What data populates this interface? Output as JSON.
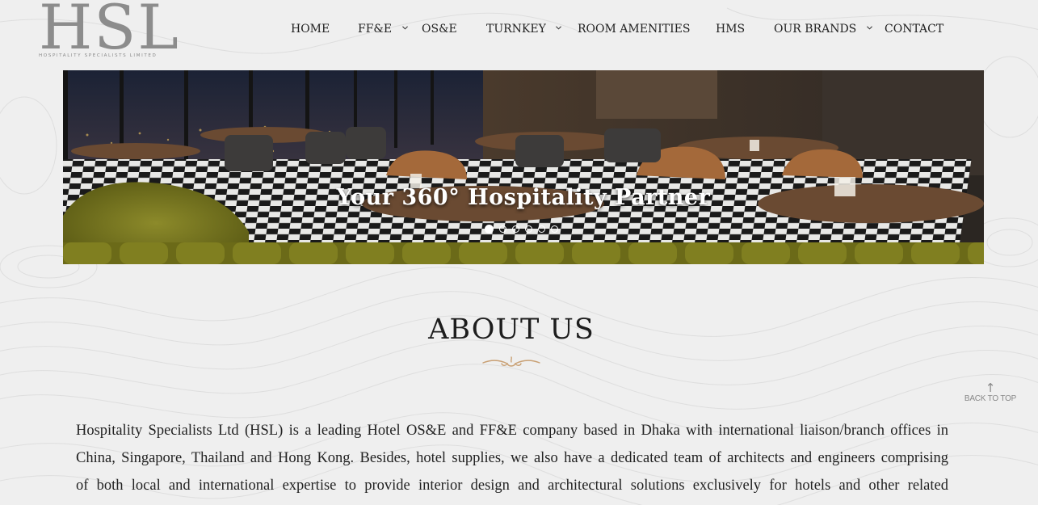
{
  "logo": {
    "main": "HSL",
    "sub": "HOSPITALITY SPECIALISTS LIMITED"
  },
  "nav": {
    "items": [
      {
        "label": "HOME",
        "dropdown": false
      },
      {
        "label": "FF&E",
        "dropdown": true
      },
      {
        "label": "OS&E",
        "dropdown": false
      },
      {
        "label": "TURNKEY",
        "dropdown": true
      },
      {
        "label": "ROOM AMENITIES",
        "dropdown": false
      },
      {
        "label": "HMS",
        "dropdown": false
      },
      {
        "label": "OUR BRANDS",
        "dropdown": true
      },
      {
        "label": "CONTACT",
        "dropdown": false
      }
    ]
  },
  "hero": {
    "caption": "Your 360° Hospitality Partner",
    "slide_count": 6,
    "active_slide": 1
  },
  "about": {
    "title": "ABOUT US",
    "lines": [
      "Hospitality Specialists Ltd (HSL) is a leading Hotel OS&E and FF&E company based in Dhaka with international liaison/branch offices in",
      "China, Singapore, Thailand and Hong Kong. Besides, hotel supplies, we also have a dedicated team of architects and engineers comprising",
      "of both local and international expertise to provide interior design and architectural solutions exclusively for hotels and other related"
    ]
  },
  "back_to_top": {
    "arrow": "↑",
    "label": "BACK TO TOP"
  },
  "colors": {
    "background": "#efefef",
    "ornament": "#c9a074",
    "text": "#222222"
  }
}
